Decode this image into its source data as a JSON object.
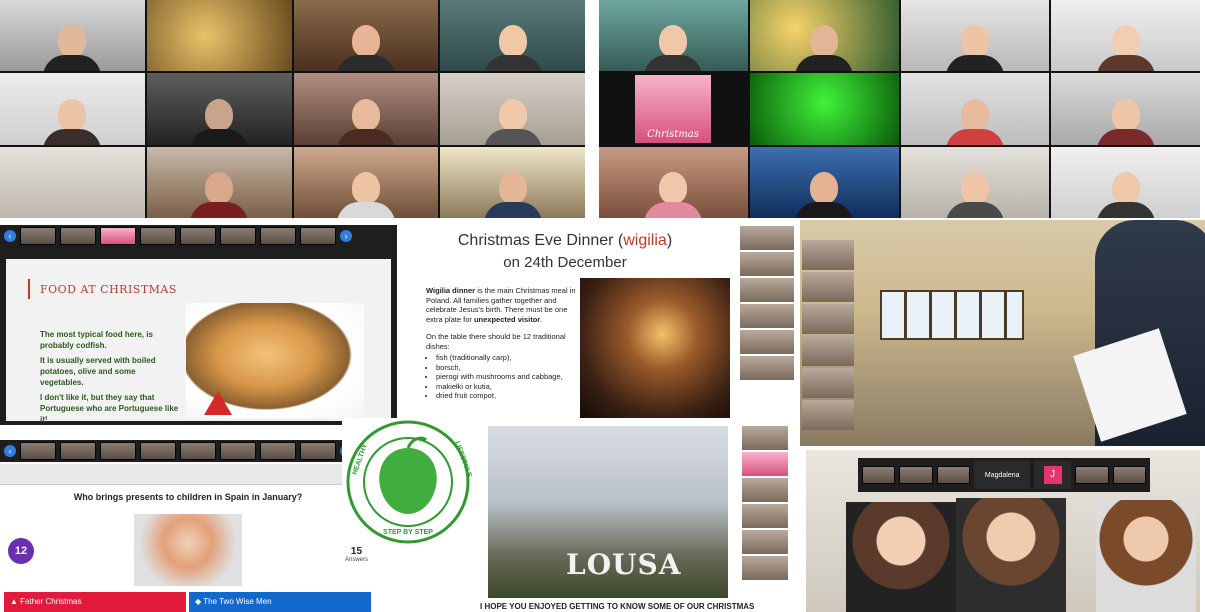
{
  "food_slide": {
    "heading": "FOOD AT CHRISTMAS",
    "para1": "The most typical food here, is probably codfish.",
    "para2": "It is usually served with boiled potatoes, olive and some vegetables.",
    "para3": "I don't like it, but they say that Portuguese who are Portuguese like it!"
  },
  "christmas_tile_label": "Christmas",
  "wigilia_slide": {
    "title_prefix": "Christmas Eve Dinner (",
    "title_highlight": "wigilia",
    "title_suffix": ")",
    "subtitle": "on 24th December",
    "intro_bold": "Wigilia dinner",
    "intro_rest": " is the main Christmas meal in Poland. All families gather together and celebrate Jesus's birth. There must be one extra plate for ",
    "intro_bold2": "unexpected visitor",
    "intro_end": ".",
    "list_intro": "On the table there should be 12 traditional dishes:",
    "dishes": [
      "fish (traditionally carp),",
      "borsch,",
      "pierogi with mushrooms and cabbage,",
      "makiełki or kutia,",
      "dried fruit compot,"
    ]
  },
  "quiz": {
    "question": "Who brings presents to children in Spain in January?",
    "timer": "12",
    "answers_count": "15",
    "answers_label": "Answers",
    "option_a": "Father Christmas",
    "option_b": "The Two Wise Men",
    "color_a": "#e21b3c",
    "color_b": "#1368ce"
  },
  "logo": {
    "ring_text_left": "HEALTHY",
    "ring_text_right": "LIFESTYLE",
    "ring_text_bottom": "STEP BY STEP",
    "color": "#2e9b2e"
  },
  "lousa_slide": {
    "sign": "LOUSA",
    "footer": "I HOPE YOU ENJOYED GETTING TO KNOW SOME OF OUR CHRISTMAS"
  },
  "reading_call": {
    "participant_label": "Magdalena",
    "avatar_letter": "J",
    "avatar_color": "#e8336f"
  }
}
